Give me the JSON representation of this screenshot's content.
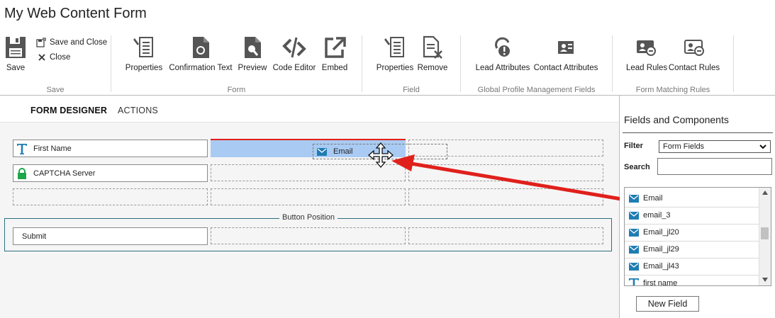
{
  "title": "My Web Content Form",
  "ribbon": {
    "save_group": {
      "label": "Save",
      "save": "Save",
      "save_close": "Save and Close",
      "close": "Close"
    },
    "form_group": {
      "label": "Form",
      "properties": "Properties",
      "confirmation": "Confirmation Text",
      "preview": "Preview",
      "code_editor": "Code Editor",
      "embed": "Embed"
    },
    "field_group": {
      "label": "Field",
      "properties": "Properties",
      "remove": "Remove"
    },
    "gpm_group": {
      "label": "Global Profile Management Fields",
      "lead_attrs": "Lead Attributes",
      "contact_attrs": "Contact Attributes"
    },
    "matching_group": {
      "label": "Form Matching Rules",
      "lead_rules": "Lead Rules",
      "contact_rules": "Contact Rules"
    }
  },
  "tabs": {
    "designer": "FORM DESIGNER",
    "actions": "ACTIONS"
  },
  "canvas": {
    "fields": {
      "first_name": "First Name",
      "captcha": "CAPTCHA Server",
      "submit": "Submit"
    },
    "button_position": "Button Position",
    "drag_item": "Email"
  },
  "panel": {
    "title": "Fields and Components",
    "filter_label": "Filter",
    "filter_value": "Form Fields",
    "search_label": "Search",
    "search_value": "",
    "items": [
      {
        "label": "Email",
        "icon": "mail-icon"
      },
      {
        "label": "email_3",
        "icon": "mail-icon"
      },
      {
        "label": "Email_jl20",
        "icon": "mail-icon"
      },
      {
        "label": "Email_jl29",
        "icon": "mail-icon"
      },
      {
        "label": "Email_jl43",
        "icon": "mail-icon"
      },
      {
        "label": "first name",
        "icon": "text-icon"
      }
    ],
    "new_field": "New Field"
  },
  "colors": {
    "accent": "#1f7db3",
    "arrow": "#e0201b",
    "selection": "#a9cbf3",
    "lock": "#1ea64a"
  }
}
